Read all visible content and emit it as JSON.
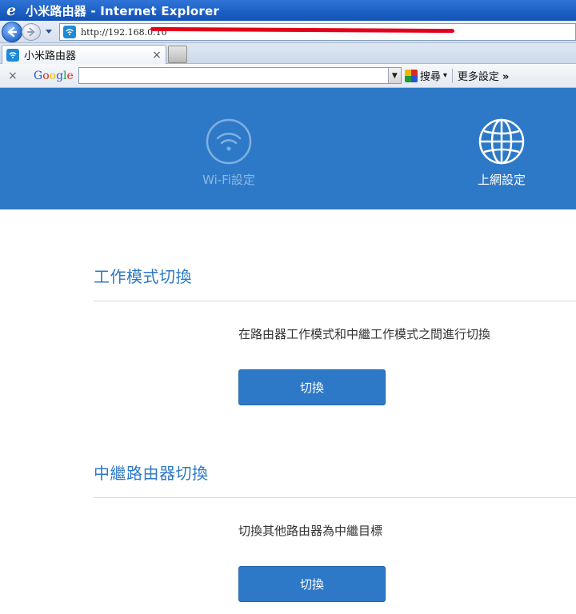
{
  "window": {
    "title": "小米路由器 - Internet Explorer"
  },
  "address_bar": {
    "url": "http://192.168.0.10"
  },
  "tabs": [
    {
      "label": "小米路由器"
    }
  ],
  "google_toolbar": {
    "close_label": "×",
    "logo": [
      "G",
      "o",
      "o",
      "g",
      "l",
      "e"
    ],
    "search_label": "搜尋",
    "search_arrow": "▾",
    "more_label": "更多設定",
    "more_arrow": "»"
  },
  "router_nav": {
    "items": [
      {
        "label": "Wi-Fi設定",
        "icon": "wifi-icon",
        "active": false
      },
      {
        "label": "上網設定",
        "icon": "globe-icon",
        "active": true
      }
    ]
  },
  "sections": [
    {
      "title": "工作模式切換",
      "description": "在路由器工作模式和中繼工作模式之間進行切換",
      "button_label": "切換"
    },
    {
      "title": "中繼路由器切換",
      "description": "切換其他路由器為中繼目標",
      "button_label": "切換"
    }
  ],
  "colors": {
    "brand_blue": "#2e79c7",
    "inactive_nav": "#8cb8e4",
    "redaction": "#e3001b"
  }
}
